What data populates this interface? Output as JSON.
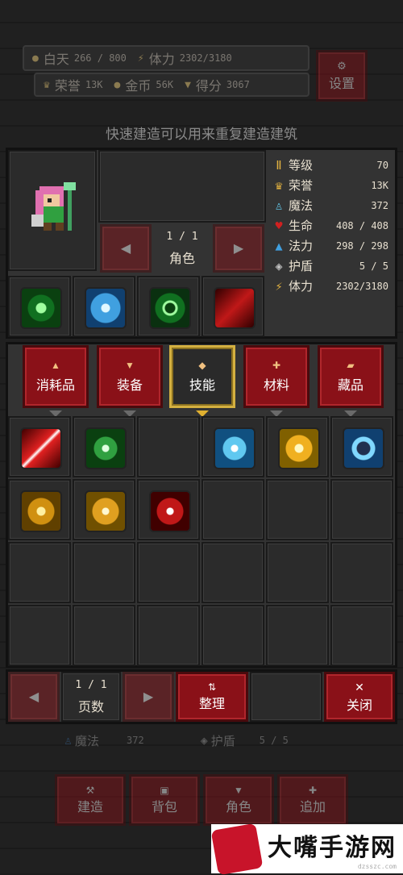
{
  "top": {
    "daytime_label": "白天",
    "daytime_value": "266 / 800",
    "stamina_label": "体力",
    "stamina_value": "2302/3180",
    "honor_label": "荣誉",
    "honor_value": "13K",
    "gold_label": "金币",
    "gold_value": "56K",
    "score_label": "得分",
    "score_value": "3067",
    "settings_label": "设置",
    "hint": "快速建造可以用来重复建造建筑"
  },
  "character": {
    "page": "1 / 1",
    "page_label": "角色",
    "stats": [
      {
        "icon": "level-icon",
        "label": "等级",
        "value": "70",
        "color": "#e0b040"
      },
      {
        "icon": "honor-crown-icon",
        "label": "荣誉",
        "value": "13K",
        "color": "#e0b040"
      },
      {
        "icon": "magic-icon",
        "label": "魔法",
        "value": "372",
        "color": "#60c0e0"
      },
      {
        "icon": "heart-icon",
        "label": "生命",
        "value": "408 / 408",
        "color": "#d02020"
      },
      {
        "icon": "potion-icon",
        "label": "法力",
        "value": "298 / 298",
        "color": "#40a0e0"
      },
      {
        "icon": "shield-icon",
        "label": "护盾",
        "value": "5 / 5",
        "color": "#c0c0c0"
      },
      {
        "icon": "stamina-icon",
        "label": "体力",
        "value": "2302/3180",
        "color": "#e0b040"
      }
    ]
  },
  "tabs": [
    {
      "label": "消耗品",
      "icon": "flask-icon"
    },
    {
      "label": "装备",
      "icon": "armor-icon"
    },
    {
      "label": "技能",
      "icon": "diamond-icon",
      "selected": true
    },
    {
      "label": "材料",
      "icon": "plus-icon"
    },
    {
      "label": "藏品",
      "icon": "scroll-icon"
    }
  ],
  "pager": {
    "page": "1 / 1",
    "page_label": "页数",
    "sort_label": "整理",
    "close_label": "关闭"
  },
  "behind": {
    "magic_label": "魔法",
    "magic_value": "372",
    "shield_label": "护盾",
    "shield_value": "5 / 5",
    "nav": [
      "建造",
      "背包",
      "角色",
      "追加"
    ]
  },
  "watermark": {
    "text": "大嘴手游网",
    "sub": "dzsszc.com"
  },
  "colors": {
    "red": "#8a1118",
    "gold": "#d4b040",
    "panel": "#333333"
  }
}
